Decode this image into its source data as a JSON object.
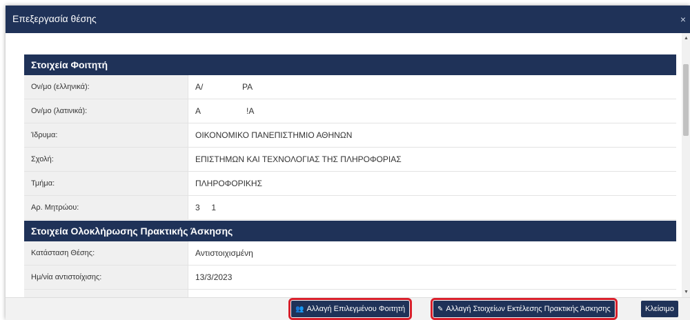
{
  "dialog": {
    "title": "Επεξεργασία θέσης",
    "close_glyph": "×"
  },
  "student_section": {
    "title": "Στοιχεία Φοιτητή",
    "rows": [
      {
        "label": "Ον/μο (ελληνικά):",
        "value": "Α/                 ΡΑ"
      },
      {
        "label": "Ον/μο (λατινικά):",
        "value": "Α                    !Α"
      },
      {
        "label": "Ίδρυμα:",
        "value": "ΟΙΚΟΝΟΜΙΚΟ ΠΑΝΕΠΙΣΤΗΜΙΟ ΑΘΗΝΩΝ"
      },
      {
        "label": "Σχολή:",
        "value": "ΕΠΙΣΤΗΜΩΝ ΚΑΙ ΤΕΧΝΟΛΟΓΙΑΣ ΤΗΣ ΠΛΗΡΟΦΟΡΙΑΣ"
      },
      {
        "label": "Τμήμα:",
        "value": "ΠΛΗΡΟΦΟΡΙΚΗΣ"
      },
      {
        "label": "Αρ. Μητρώου:",
        "value": "3     1"
      }
    ]
  },
  "completion_section": {
    "title": "Στοιχεία Ολοκλήρωσης Πρακτικής Άσκησης",
    "rows": [
      {
        "label": "Κατάσταση Θέσης:",
        "value": "Αντιστοιχισμένη"
      },
      {
        "label": "Ημ/νία αντιστοίχισης:",
        "value": "13/3/2023"
      }
    ]
  },
  "footer": {
    "change_student_label": "Αλλαγή Επιλεγμένου Φοιτητή",
    "change_details_label": "Αλλαγή Στοιχείων Εκτέλεσης Πρακτικής Άσκησης",
    "close_label": "Κλείσιμο"
  },
  "colors": {
    "header": "#1f3258",
    "highlight": "#d81e2a",
    "label_bg": "#f0f0f0"
  },
  "icons": {
    "change_student": "users-icon",
    "change_details": "pencil-icon"
  }
}
